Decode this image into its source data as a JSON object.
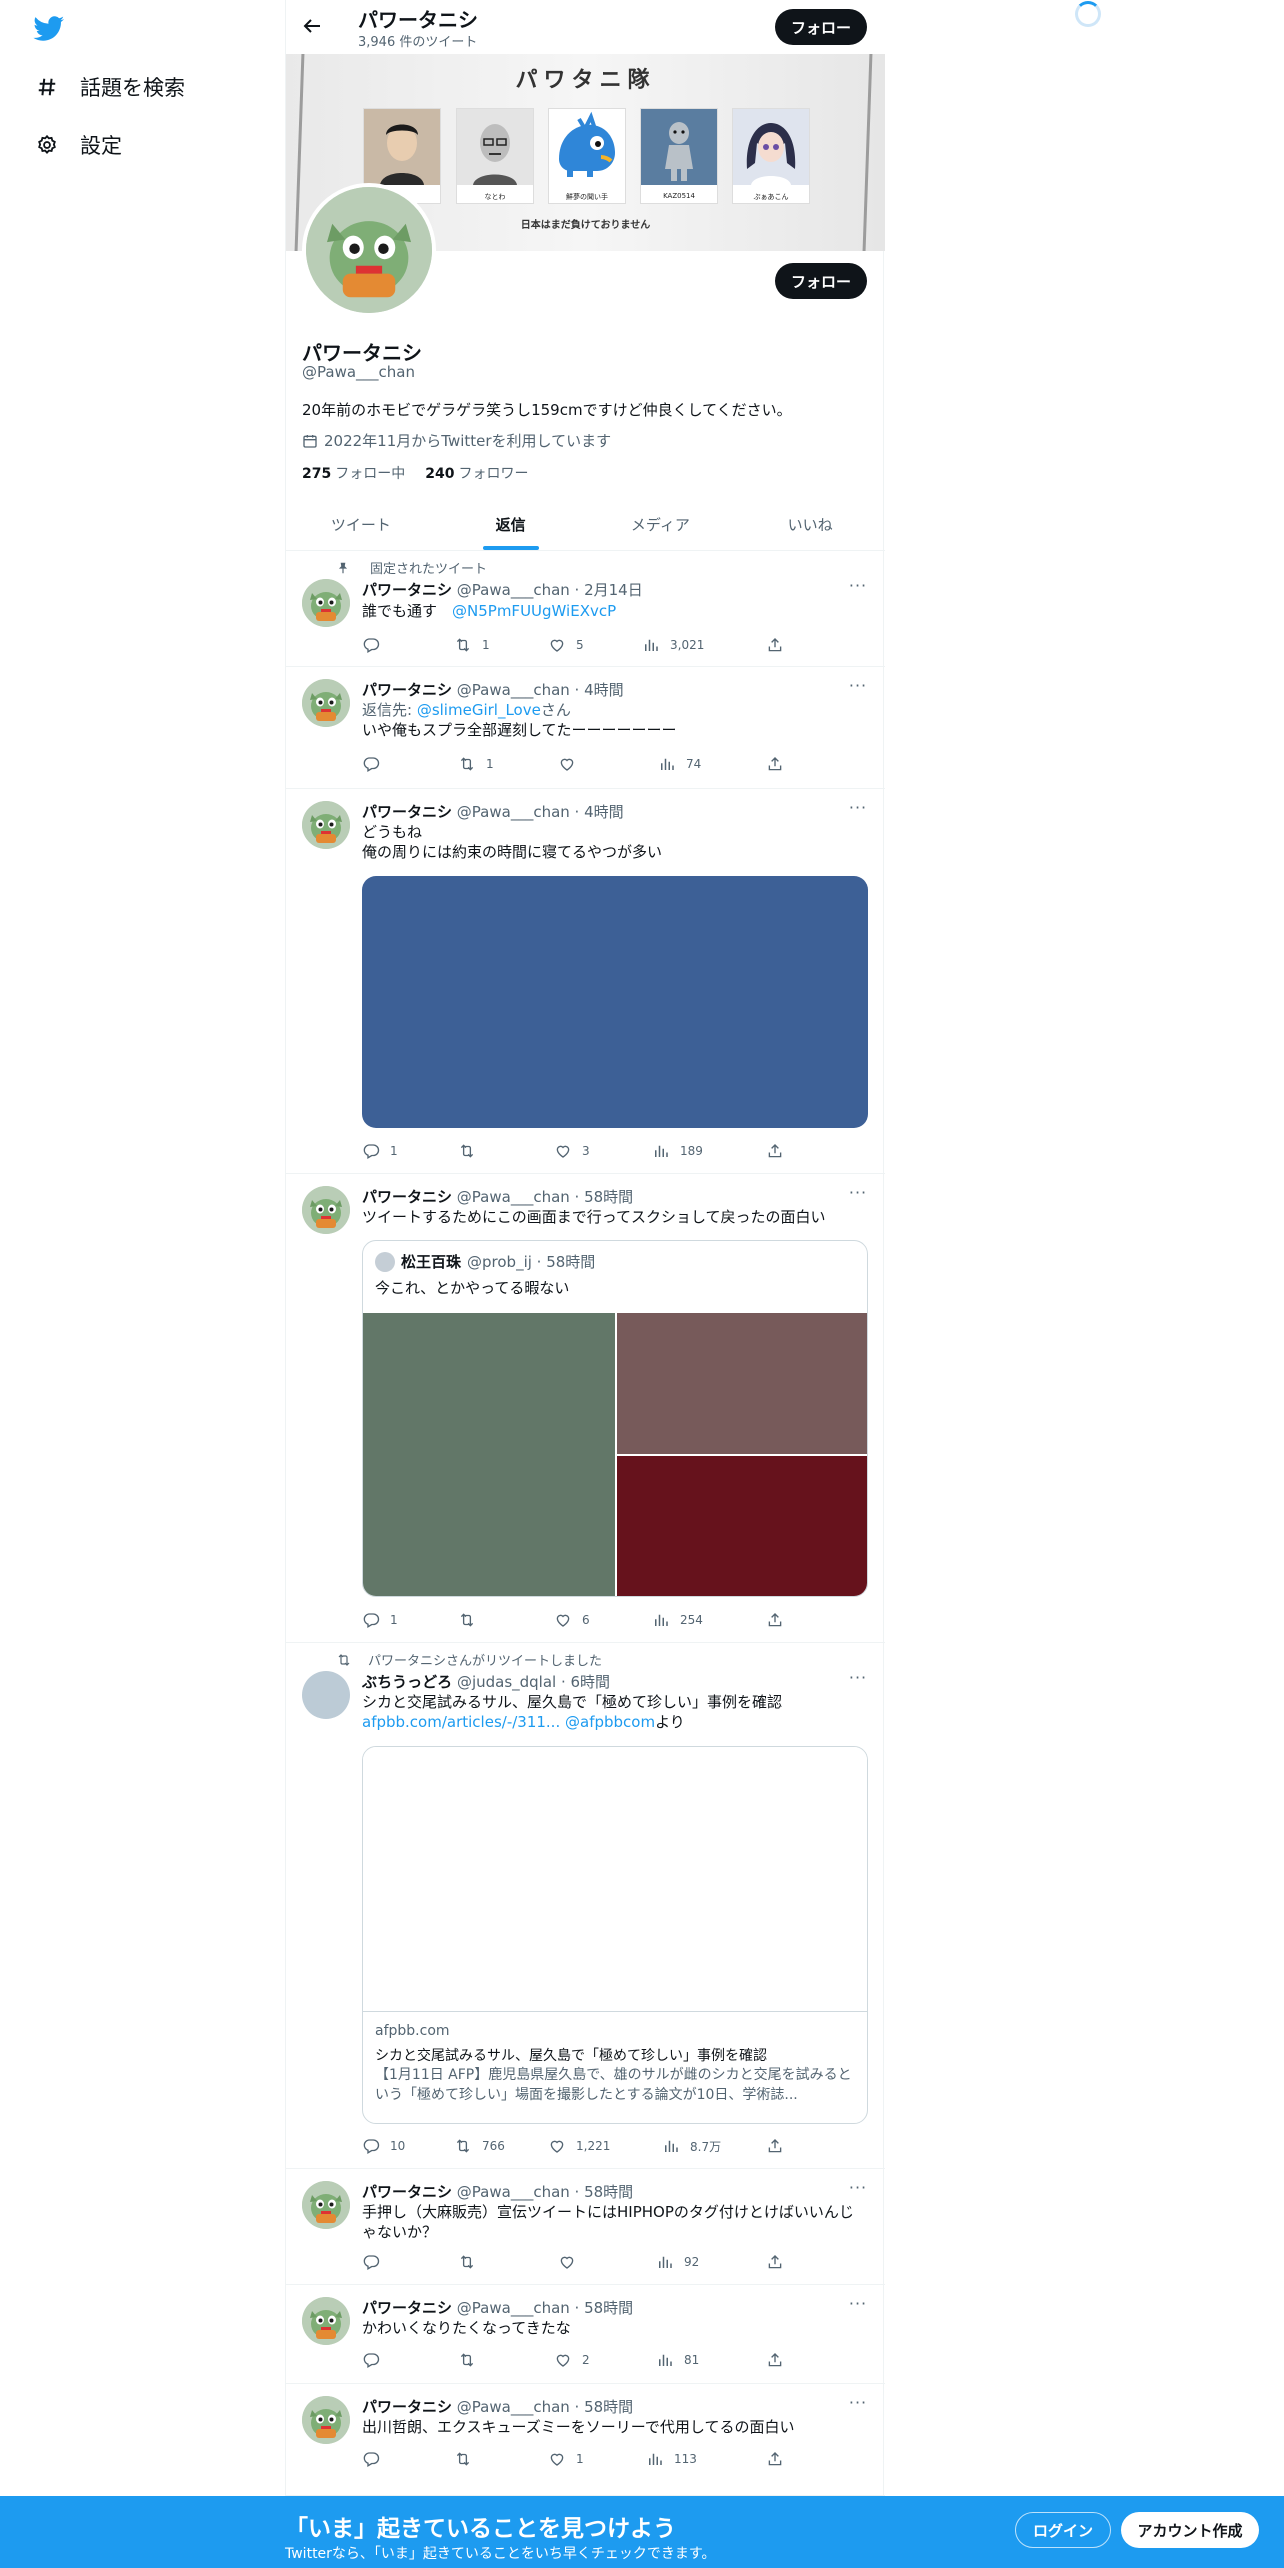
{
  "nav": {
    "explore_label": "話題を検索",
    "settings_label": "設定"
  },
  "header": {
    "name": "パワータニシ",
    "tweet_count": "3,946 件のツイート",
    "follow_label": "フォロー"
  },
  "banner": {
    "title": "パワタニ隊",
    "captions": [
      "",
      "なとわ",
      "鮮夢の聞い手",
      "KAZ0514",
      "ぷぁあこん"
    ],
    "footer": "日本はまだ負けておりません"
  },
  "profile": {
    "name": "パワータニシ",
    "handle": "@Pawa___chan",
    "bio": "20年前のホモビでゲラゲラ笑うし159cmですけど仲良くしてください。",
    "joined": "2022年11月からTwitterを利用しています",
    "following_count": "275",
    "following_label": "フォロー中",
    "followers_count": "240",
    "followers_label": "フォロワー",
    "follow_label": "フォロー"
  },
  "tabs": [
    "ツイート",
    "返信",
    "メディア",
    "いいね"
  ],
  "tweets": [
    {
      "context": "固定されたツイート",
      "name": "パワータニシ",
      "meta": "@Pawa___chan · 2月14日",
      "text_before": "誰でも通す　",
      "link": "@N5PmFUUgWiEXvcP",
      "reply": "",
      "retweet": "1",
      "like": "5",
      "views": "3,021"
    },
    {
      "name": "パワータニシ",
      "meta": "@Pawa___chan · 4時間",
      "reply_to_label": "返信先: ",
      "reply_to_user": "@slimeGirl_Love",
      "reply_to_suffix": "さん",
      "text": "いや俺もスプラ全部遅刻してたーーーーーーー",
      "reply": "",
      "retweet": "1",
      "like": "",
      "views": "74"
    },
    {
      "name": "パワータニシ",
      "meta": "@Pawa___chan · 4時間",
      "text1": "どうもね",
      "text2": "俺の周りには約束の時間に寝てるやつが多い",
      "reply": "1",
      "retweet": "",
      "like": "3",
      "views": "189"
    },
    {
      "name": "パワータニシ",
      "meta": "@Pawa___chan · 58時間",
      "text": "ツイートするためにこの画面まで行ってスクショして戻ったの面白い",
      "quote_name": "松王百珠",
      "quote_meta": "@prob_ij · 58時間",
      "quote_text": "今これ、とかやってる暇ない",
      "reply": "1",
      "retweet": "",
      "like": "6",
      "views": "254"
    },
    {
      "context": "パワータニシさんがリツイートしました",
      "name": "ぶちうっどろ",
      "meta": "@judas_dqlal · 6時間",
      "text": "シカと交尾試みるサル、屋久島で「極めて珍しい」事例を確認",
      "link1": "afpbb.com/articles/-/311...",
      "link2": "@afpbbcom",
      "link_suffix": "より",
      "card_domain": "afpbb.com",
      "card_title": "シカと交尾試みるサル、屋久島で「極めて珍しい」事例を確認",
      "card_desc": "【1月11日 AFP】鹿児島県屋久島で、雄のサルが雌のシカと交尾を試みるという「極めて珍しい」場面を撮影したとする論文が10日、学術誌...",
      "reply": "10",
      "retweet": "766",
      "like": "1,221",
      "views": "8.7万"
    },
    {
      "name": "パワータニシ",
      "meta": "@Pawa___chan · 58時間",
      "text1": "手押し（大麻販売）宣伝ツイートにはHIPHOPのタグ付けとけばいいんじ",
      "text2": "ゃないか？",
      "reply": "",
      "retweet": "",
      "like": "",
      "views": "92"
    },
    {
      "name": "パワータニシ",
      "meta": "@Pawa___chan · 58時間",
      "text": "かわいくなりたくなってきたな",
      "reply": "",
      "retweet": "",
      "like": "2",
      "views": "81"
    },
    {
      "name": "パワータニシ",
      "meta": "@Pawa___chan · 58時間",
      "text": "出川哲朗、エクスキューズミーをソーリーで代用してるの面白い",
      "reply": "",
      "retweet": "",
      "like": "1",
      "views": "113"
    }
  ],
  "bottom": {
    "title": "「いま」起きていることを見つけよう",
    "subtitle": "Twitterなら、「いま」起きていることをいち早くチェックできます。",
    "login": "ログイン",
    "signup": "アカウント作成"
  },
  "colors": {
    "accent": "#1d9bf0",
    "media_blue": "#3d6096",
    "media_green": "#627768",
    "media_mauve": "#775a5a",
    "media_red": "#66121c"
  }
}
